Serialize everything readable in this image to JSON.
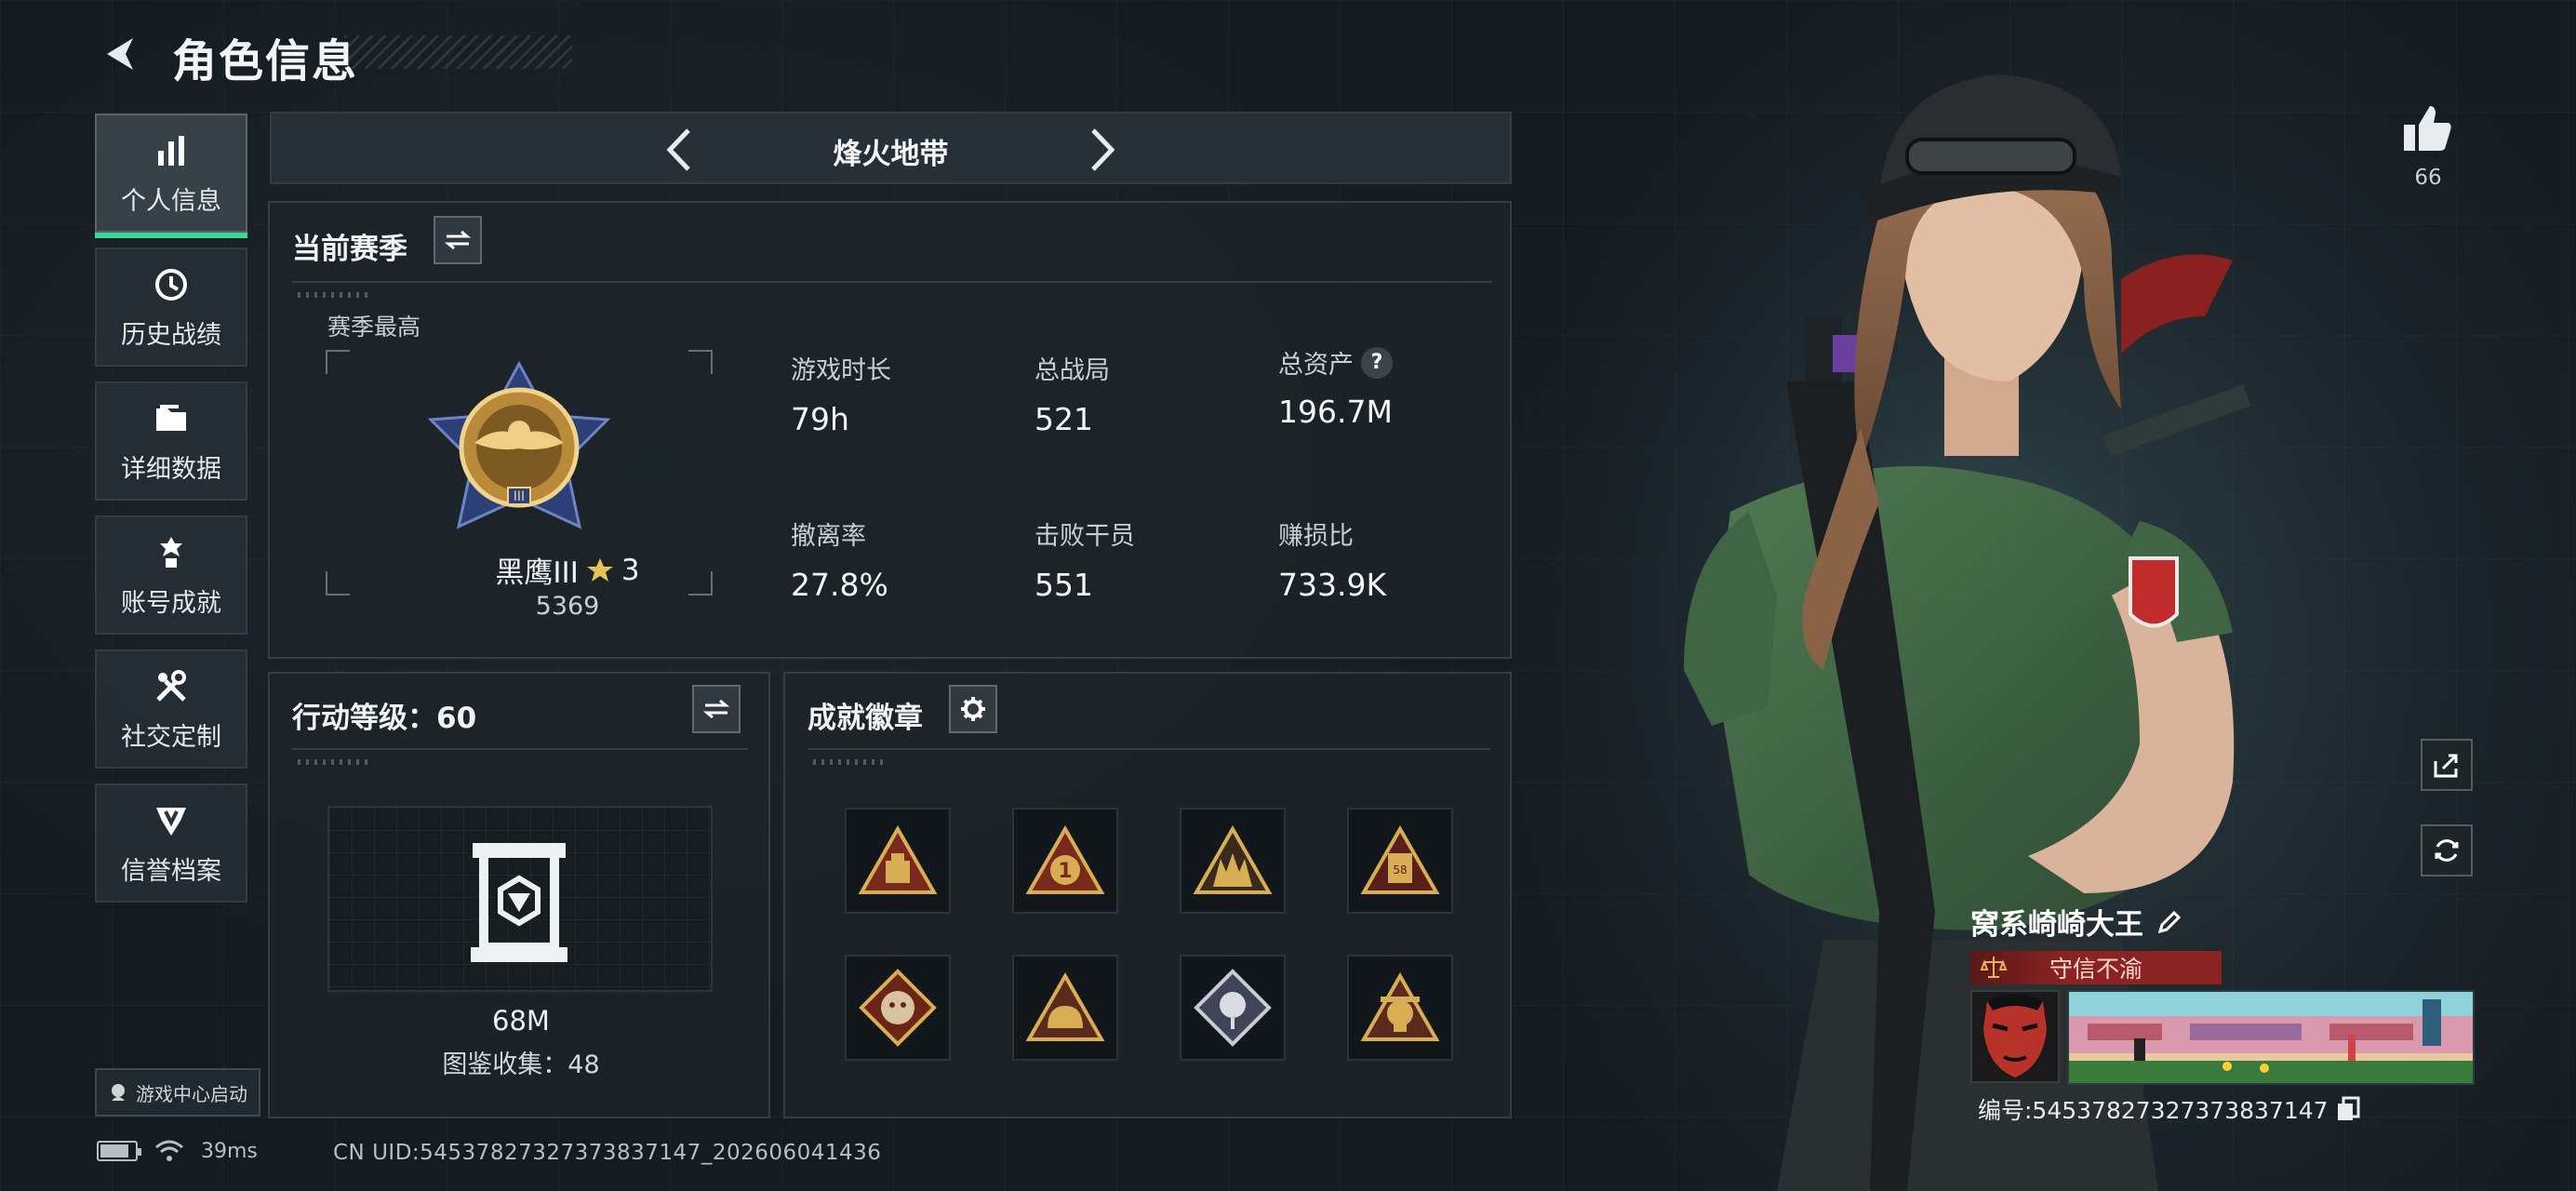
{
  "header": {
    "title": "角色信息",
    "back_icon": "back-arrow-icon"
  },
  "sidebar": {
    "items": [
      {
        "label": "个人信息",
        "icon": "bar-chart-icon",
        "active": true
      },
      {
        "label": "历史战绩",
        "icon": "history-clock-icon",
        "active": false
      },
      {
        "label": "详细数据",
        "icon": "folder-icon",
        "active": false
      },
      {
        "label": "账号成就",
        "icon": "medal-icon",
        "active": false
      },
      {
        "label": "社交定制",
        "icon": "tools-icon",
        "active": false
      },
      {
        "label": "信誉档案",
        "icon": "shield-icon",
        "active": false
      }
    ],
    "launch_label": "游戏中心启动"
  },
  "mode": {
    "title": "烽火地带"
  },
  "season": {
    "title": "当前赛季",
    "best_label": "赛季最高",
    "rank_name": "黑鹰III",
    "rank_stars": "3",
    "rank_score": "5369",
    "stats": [
      {
        "label": "游戏时长",
        "value": "79h"
      },
      {
        "label": "总战局",
        "value": "521"
      },
      {
        "label": "总资产",
        "value": "196.7M",
        "help": "?"
      },
      {
        "label": "撤离率",
        "value": "27.8%"
      },
      {
        "label": "击败干员",
        "value": "551"
      },
      {
        "label": "赚损比",
        "value": "733.9K"
      }
    ]
  },
  "action_level": {
    "title": "行动等级：60",
    "value": "68M",
    "collection": "图鉴收集：48"
  },
  "achievements": {
    "title": "成就徽章",
    "badges": [
      "box-badge-icon",
      "number-one-badge-icon",
      "squad-badge-icon",
      "card-badge-icon",
      "beast-badge-icon",
      "helmet-badge-icon",
      "rose-badge-icon",
      "skull-badge-icon"
    ]
  },
  "right": {
    "likes": "66",
    "player_name": "窝系崎崎大王",
    "honor": "守信不渝",
    "player_id": "编号:54537827327373837147"
  },
  "status": {
    "ping": "39ms",
    "uid": "CN UID:54537827327373837147_202606041436"
  },
  "colors": {
    "accent": "#37d89a",
    "honor": "#8c2323",
    "badge_gold": "#c9a24a"
  }
}
